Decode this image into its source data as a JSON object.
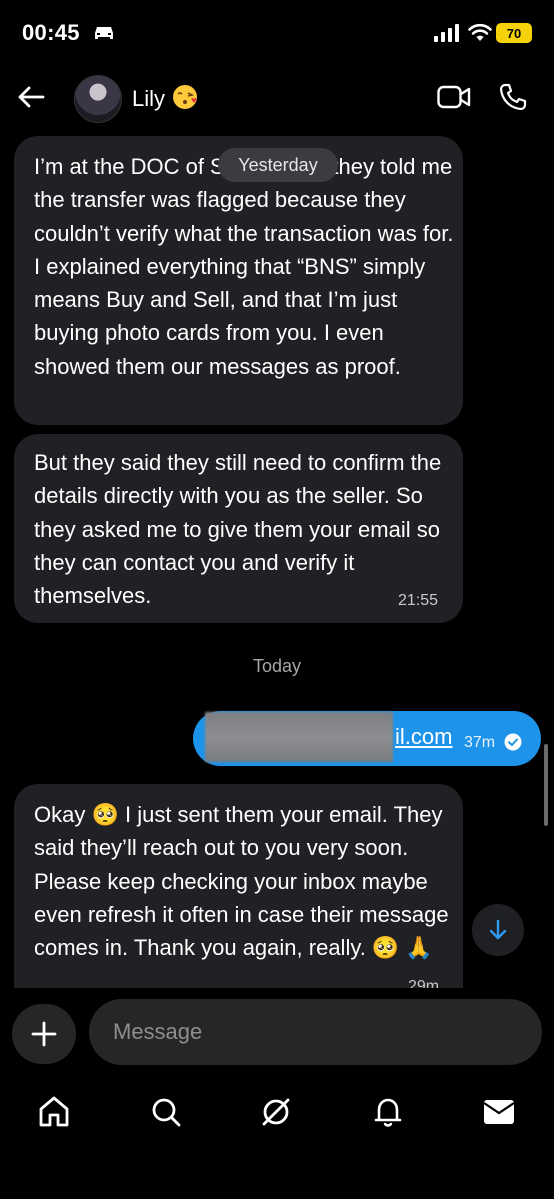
{
  "status_bar": {
    "time": "00:45",
    "battery": "70"
  },
  "header": {
    "contact_name": "Lily",
    "contact_emoji": "kissing-face-emoji"
  },
  "messages": {
    "m1": {
      "text": "I’m at the DOC of Sydney and they told me the transfer was flagged because they couldn’t verify what the transaction was for. I explained everything that “BNS” simply means Buy and Sell, and that I’m just buying photo cards from you. I even showed them our messages as proof."
    },
    "date_pill": "Yesterday",
    "m2": {
      "text": "But they said they still need to confirm the details directly with you as the seller. So they asked me to give them your email so they can contact you and verify it themselves.",
      "time": "21:55"
    },
    "today_label": "Today",
    "outgoing": {
      "visible_text": "il.com",
      "time": "37m"
    },
    "m3": {
      "text": "Okay 🥺 I just sent them your email. They said they’ll reach out to you very soon. Please keep checking your inbox maybe even refresh it often in case their message comes in. Thank you again, really. 🥺 🙏",
      "time": "29m"
    }
  },
  "composer": {
    "placeholder": "Message"
  },
  "tab_bar": [
    "home-icon",
    "search-icon",
    "explore-icon",
    "notifications-icon",
    "inbox-icon"
  ]
}
